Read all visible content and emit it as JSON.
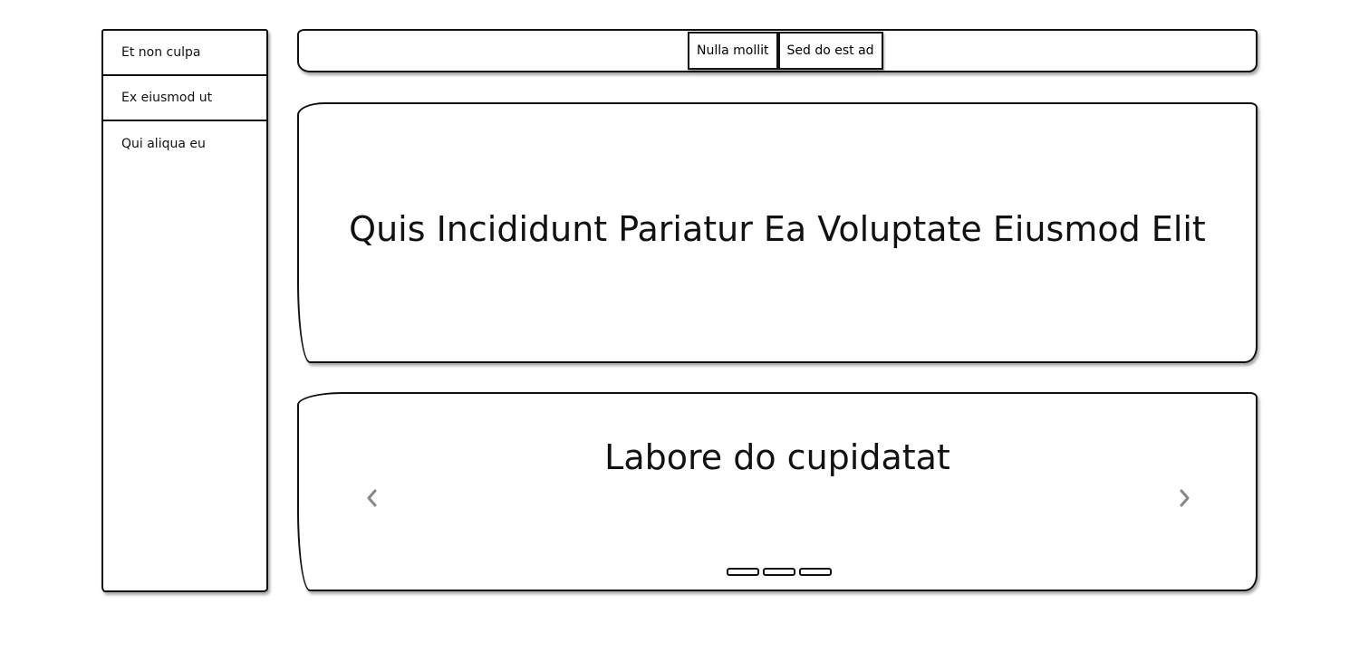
{
  "sidebar": {
    "items": [
      {
        "label": "Et non culpa"
      },
      {
        "label": "Ex eiusmod ut"
      },
      {
        "label": "Qui aliqua eu"
      }
    ]
  },
  "topbar": {
    "buttons": [
      {
        "label": "Nulla mollit"
      },
      {
        "label": "Sed do est ad"
      }
    ]
  },
  "hero": {
    "title": "Quis Incididunt Pariatur Ea Voluptate Eiusmod Elit"
  },
  "carousel": {
    "slide_title": "Labore do cupidatat",
    "prev_icon": "chevron-left-icon",
    "next_icon": "chevron-right-icon",
    "slide_count": 3,
    "arrow_color": "#888888"
  }
}
